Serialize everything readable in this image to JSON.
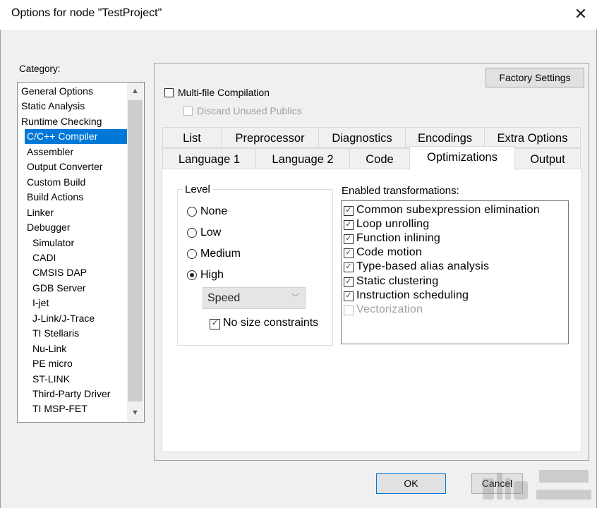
{
  "window": {
    "title": "Options for node \"TestProject\""
  },
  "category": {
    "label": "Category:",
    "items": [
      {
        "label": "General Options",
        "indent": 0
      },
      {
        "label": "Static Analysis",
        "indent": 0
      },
      {
        "label": "Runtime Checking",
        "indent": 0
      },
      {
        "label": "C/C++ Compiler",
        "indent": 1,
        "selected": true
      },
      {
        "label": "Assembler",
        "indent": 1
      },
      {
        "label": "Output Converter",
        "indent": 1
      },
      {
        "label": "Custom Build",
        "indent": 1
      },
      {
        "label": "Build Actions",
        "indent": 1
      },
      {
        "label": "Linker",
        "indent": 1
      },
      {
        "label": "Debugger",
        "indent": 1
      },
      {
        "label": "Simulator",
        "indent": 2
      },
      {
        "label": "CADI",
        "indent": 2
      },
      {
        "label": "CMSIS DAP",
        "indent": 2
      },
      {
        "label": "GDB Server",
        "indent": 2
      },
      {
        "label": "I-jet",
        "indent": 2
      },
      {
        "label": "J-Link/J-Trace",
        "indent": 2
      },
      {
        "label": "TI Stellaris",
        "indent": 2
      },
      {
        "label": "Nu-Link",
        "indent": 2
      },
      {
        "label": "PE micro",
        "indent": 2
      },
      {
        "label": "ST-LINK",
        "indent": 2
      },
      {
        "label": "Third-Party Driver",
        "indent": 2
      },
      {
        "label": "TI MSP-FET",
        "indent": 2
      }
    ]
  },
  "panel": {
    "factory_settings": "Factory Settings",
    "multifile": {
      "label": "Multi-file Compilation",
      "checked": false
    },
    "discard": {
      "label": "Discard Unused Publics",
      "checked": false,
      "disabled": true
    }
  },
  "tabs": {
    "row_top": [
      "List",
      "Preprocessor",
      "Diagnostics",
      "Encodings",
      "Extra Options"
    ],
    "row_bottom": [
      "Language 1",
      "Language 2",
      "Code",
      "Optimizations",
      "Output"
    ],
    "active": "Optimizations"
  },
  "optimizations": {
    "level": {
      "title": "Level",
      "options": [
        "None",
        "Low",
        "Medium",
        "High"
      ],
      "selected": "High",
      "high_mode": "Speed",
      "no_size_constraints": {
        "label": "No size constraints",
        "checked": true
      }
    },
    "transformations": {
      "title": "Enabled transformations:",
      "items": [
        {
          "label": "Common subexpression elimination",
          "checked": true,
          "disabled": false
        },
        {
          "label": "Loop unrolling",
          "checked": true,
          "disabled": false
        },
        {
          "label": "Function inlining",
          "checked": true,
          "disabled": false
        },
        {
          "label": "Code motion",
          "checked": true,
          "disabled": false
        },
        {
          "label": "Type-based alias analysis",
          "checked": true,
          "disabled": false
        },
        {
          "label": "Static clustering",
          "checked": true,
          "disabled": false
        },
        {
          "label": "Instruction scheduling",
          "checked": true,
          "disabled": false
        },
        {
          "label": "Vectorization",
          "checked": false,
          "disabled": true
        }
      ]
    }
  },
  "buttons": {
    "ok": "OK",
    "cancel": "Cancel"
  },
  "colors": {
    "selection": "#0078d7",
    "dialog_bg": "#f0f0f0"
  }
}
